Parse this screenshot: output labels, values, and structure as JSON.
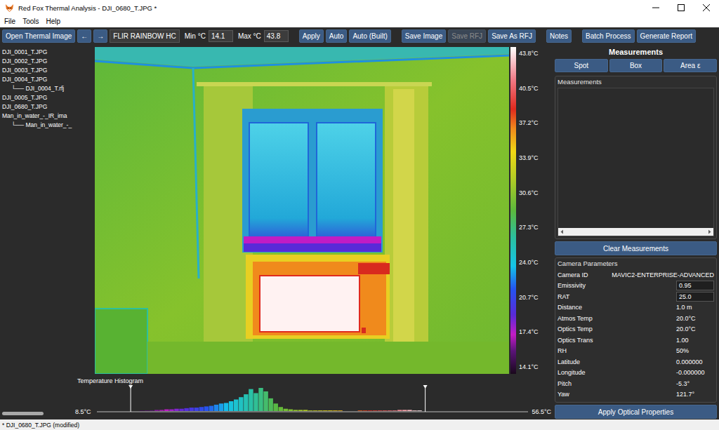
{
  "window": {
    "title": "Red Fox Thermal Analysis - DJI_0680_T.JPG *"
  },
  "menu": [
    {
      "label": "File"
    },
    {
      "label": "Tools"
    },
    {
      "label": "Help"
    }
  ],
  "toolbar": {
    "groups": [
      [
        {
          "kind": "button",
          "label": "Open Thermal Image",
          "disabled": false
        },
        {
          "kind": "button",
          "label": "←",
          "disabled": false
        },
        {
          "kind": "button",
          "label": "→",
          "disabled": false
        },
        {
          "kind": "select",
          "value": "FLIR RAINBOW HC"
        },
        {
          "kind": "field",
          "label": "Min °C",
          "value": "14.1"
        },
        {
          "kind": "field",
          "label": "Max °C",
          "value": "43.8"
        }
      ],
      [
        {
          "kind": "button",
          "label": "Apply",
          "disabled": false
        },
        {
          "kind": "button",
          "label": "Auto",
          "disabled": false
        },
        {
          "kind": "button",
          "label": "Auto (Built)",
          "disabled": false
        }
      ],
      [
        {
          "kind": "button",
          "label": "Save Image",
          "disabled": false
        },
        {
          "kind": "button",
          "label": "Save RFJ",
          "disabled": true
        },
        {
          "kind": "button",
          "label": "Save As RFJ",
          "disabled": false
        }
      ],
      [
        {
          "kind": "button",
          "label": "Notes",
          "disabled": false
        }
      ],
      [
        {
          "kind": "button",
          "label": "Batch Process",
          "disabled": false
        },
        {
          "kind": "button",
          "label": "Generate Report",
          "disabled": false
        }
      ]
    ]
  },
  "file_tree": {
    "items": [
      {
        "label": "DJI_0001_T.JPG",
        "depth": 0,
        "selected": false
      },
      {
        "label": "DJI_0002_T.JPG",
        "depth": 0,
        "selected": false
      },
      {
        "label": "DJI_0003_T.JPG",
        "depth": 0,
        "selected": false
      },
      {
        "label": "DJI_0004_T.JPG",
        "depth": 0,
        "selected": false
      },
      {
        "label": "└── DJI_0004_T.rfj",
        "depth": 1,
        "selected": false
      },
      {
        "label": "DJI_0005_T.JPG",
        "depth": 0,
        "selected": false
      },
      {
        "label": "DJI_0680_T.JPG",
        "depth": 0,
        "selected": false
      },
      {
        "label": "Man_in_water_-_IR_ima",
        "depth": 0,
        "selected": false
      },
      {
        "label": "└── Man_in_water_-_",
        "depth": 1,
        "selected": false
      }
    ],
    "scrollbar": {
      "level": 0.6
    }
  },
  "thermal_view": {
    "colorbar": {
      "ticks": [
        "43.8°C",
        "40.5°C",
        "37.2°C",
        "33.9°C",
        "30.6°C",
        "27.3°C",
        "24.0°C",
        "20.7°C",
        "17.4°C",
        "14.1°C"
      ]
    }
  },
  "histogram": {
    "title": "Temperature Histogram",
    "axis_min_label": "8.5°C",
    "axis_max_label": "56.5°C",
    "axis_min": 8.5,
    "axis_max": 56.5,
    "markers": [
      14.1,
      43.8
    ],
    "bin_start": 14.0,
    "bin_width": 0.5,
    "counts": [
      0,
      0,
      1,
      1,
      1,
      2,
      2,
      3,
      3,
      4,
      4,
      5,
      6,
      6,
      7,
      8,
      9,
      11,
      13,
      14,
      17,
      20,
      24,
      29,
      38,
      31,
      40,
      34,
      22,
      13,
      7,
      4,
      3,
      2,
      2,
      2,
      1,
      1,
      1,
      1,
      1,
      1,
      1,
      0,
      0,
      0,
      1,
      1,
      1,
      1,
      1,
      1,
      1,
      1,
      2,
      2,
      2,
      1,
      1,
      0
    ]
  },
  "measurements_panel": {
    "title": "Measurements",
    "tools": [
      {
        "label": "Spot",
        "selected": false
      },
      {
        "label": "Box",
        "selected": false
      },
      {
        "label": "Area ε",
        "selected": false
      }
    ],
    "list": {
      "title": "Measurements",
      "items": []
    },
    "clear_button": "Clear Measurements"
  },
  "camera_parameters": {
    "title": "Camera Parameters",
    "rows": [
      {
        "label": "Camera ID",
        "value": "MAVIC2-ENTERPRISE-ADVANCED",
        "kind": "text"
      },
      {
        "label": "Emissivity",
        "value": "0.95",
        "kind": "field"
      },
      {
        "label": "RAT",
        "value": "25.0",
        "kind": "field"
      },
      {
        "label": "Distance",
        "value": "1.0 m",
        "kind": "text"
      },
      {
        "label": "Atmos Temp",
        "value": "20.0°C",
        "kind": "text"
      },
      {
        "label": "Optics Temp",
        "value": "20.0°C",
        "kind": "text"
      },
      {
        "label": "Optics Trans",
        "value": "1.00",
        "kind": "text"
      },
      {
        "label": "RH",
        "value": "50%",
        "kind": "text"
      },
      {
        "label": "Latitude",
        "value": "0.000000",
        "kind": "text"
      },
      {
        "label": "Longitude",
        "value": "-0.000000",
        "kind": "text"
      },
      {
        "label": "Pitch",
        "value": "-5.3°",
        "kind": "text"
      },
      {
        "label": "Yaw",
        "value": "121.7°",
        "kind": "text"
      }
    ],
    "apply_button": "Apply Optical Properties"
  },
  "status_bar": {
    "text": "* DJI_0680_T.JPG (modified)"
  }
}
